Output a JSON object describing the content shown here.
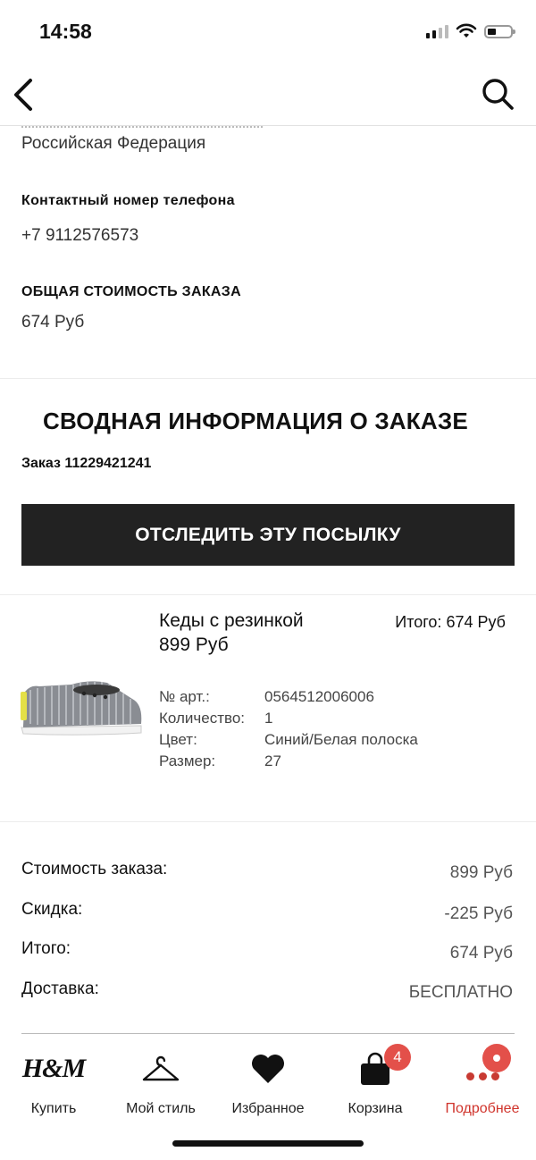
{
  "status_bar": {
    "time": "14:58"
  },
  "address": {
    "country": "Российская Федерация"
  },
  "contact": {
    "label": "Контактный номер телефона",
    "phone": "+7 9112576573"
  },
  "order_cost": {
    "label": "ОБЩАЯ СТОИМОСТЬ ЗАКАЗА",
    "value": "674 Руб"
  },
  "summary": {
    "title": "СВОДНАЯ ИНФОРМАЦИЯ О ЗАКАЗЕ",
    "order_number": "Заказ 11229421241",
    "track_button": "ОТСЛЕДИТЬ ЭТУ ПОСЫЛКУ"
  },
  "product": {
    "name": "Кеды с резинкой",
    "price": "899 Руб",
    "total": "Итого: 674 Руб",
    "attributes": [
      {
        "key": "№ арт.:",
        "value": "0564512006006"
      },
      {
        "key": "Количество:",
        "value": "1"
      },
      {
        "key": "Цвет:",
        "value": "Синий/Белая полоска"
      },
      {
        "key": "Размер:",
        "value": "27"
      }
    ]
  },
  "totals": [
    {
      "key": "Стоимость заказа:",
      "value": "899 Руб"
    },
    {
      "key": "Скидка:",
      "value": "-225 Руб"
    },
    {
      "key": "Итого:",
      "value": "674 Руб"
    },
    {
      "key": "Доставка:",
      "value": "БЕСПЛАТНО"
    }
  ],
  "tabbar": {
    "items": [
      {
        "label": "Купить",
        "icon": "hm-logo-icon",
        "logo_text": "H&M"
      },
      {
        "label": "Мой стиль",
        "icon": "hanger-icon"
      },
      {
        "label": "Избранное",
        "icon": "heart-icon"
      },
      {
        "label": "Корзина",
        "icon": "bag-icon",
        "badge": "4"
      },
      {
        "label": "Подробнее",
        "icon": "more-icon"
      }
    ],
    "active": "Подробнее",
    "active_color": "#d0342c",
    "badge_color": "#e3504a"
  }
}
